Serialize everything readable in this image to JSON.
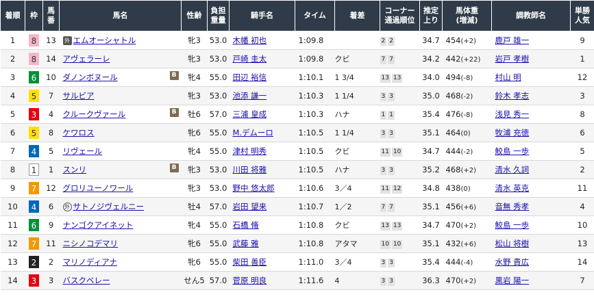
{
  "header": {
    "rank": "着順",
    "waku": "枠",
    "uma_ban": "馬\n番",
    "horse": "馬名",
    "sex_age": "性齢",
    "weight_carried": "負担\n重量",
    "jockey": "騎手名",
    "time": "タイム",
    "margin": "着差",
    "corner": "コーナー\n通過順位",
    "last3f": "推定\n上り",
    "body_weight": "馬体重\n(増減)",
    "trainer": "調教師名",
    "odds": "単勝\n人気"
  },
  "rows": [
    {
      "rank": "1",
      "waku": "8",
      "ban": "13",
      "mark": "kaku",
      "mark_text": "外",
      "horse": "エムオーシャトル",
      "blinker": "",
      "sexage": "牝3",
      "kin": "53.0",
      "jockey": "木幡 初也",
      "time": "1:09.8",
      "margin": "",
      "c1": "2",
      "c2": "2",
      "agari": "34.7",
      "bw": "454",
      "bwd": "(+2)",
      "trainer": "鹿戸 雄一",
      "pop": "9"
    },
    {
      "rank": "2",
      "waku": "8",
      "ban": "14",
      "mark": "",
      "mark_text": "",
      "horse": "アヴェラーレ",
      "blinker": "",
      "sexage": "牝3",
      "kin": "53.0",
      "jockey": "戸崎 圭太",
      "time": "1:09.8",
      "margin": "クビ",
      "c1": "7",
      "c2": "7",
      "agari": "34.2",
      "bw": "442",
      "bwd": "(+22)",
      "trainer": "岩戸 孝樹",
      "pop": "1"
    },
    {
      "rank": "3",
      "waku": "6",
      "ban": "10",
      "mark": "",
      "mark_text": "",
      "horse": "ダノンボヌール",
      "blinker": "B",
      "sexage": "牝4",
      "kin": "55.0",
      "jockey": "田辺 裕信",
      "time": "1:10.1",
      "margin": "1 3/4",
      "c1": "13",
      "c2": "13",
      "agari": "34.0",
      "bw": "494",
      "bwd": "(-8)",
      "trainer": "村山 明",
      "pop": "12"
    },
    {
      "rank": "4",
      "waku": "5",
      "ban": "7",
      "mark": "",
      "mark_text": "",
      "horse": "サルビア",
      "blinker": "",
      "sexage": "牝3",
      "kin": "53.0",
      "jockey": "池添 謙一",
      "time": "1:10.3",
      "margin": "1 1/4",
      "c1": "3",
      "c2": "3",
      "agari": "35.0",
      "bw": "468",
      "bwd": "(-2)",
      "trainer": "鈴木 孝志",
      "pop": "3"
    },
    {
      "rank": "5",
      "waku": "3",
      "ban": "4",
      "mark": "",
      "mark_text": "",
      "horse": "クルークヴァール",
      "blinker": "B",
      "sexage": "牡6",
      "kin": "57.0",
      "jockey": "三浦 皇成",
      "time": "1:10.3",
      "margin": "ハナ",
      "c1": "1",
      "c2": "1",
      "agari": "35.4",
      "bw": "476",
      "bwd": "(-8)",
      "trainer": "浅見 秀一",
      "pop": "8"
    },
    {
      "rank": "6",
      "waku": "5",
      "ban": "8",
      "mark": "",
      "mark_text": "",
      "horse": "ケワロス",
      "blinker": "",
      "sexage": "牝6",
      "kin": "55.0",
      "jockey": "M.デムーロ",
      "time": "1:10.5",
      "margin": "1 1/4",
      "c1": "3",
      "c2": "3",
      "agari": "35.1",
      "bw": "464",
      "bwd": "(0)",
      "trainer": "牧浦 充徳",
      "pop": "6"
    },
    {
      "rank": "7",
      "waku": "4",
      "ban": "5",
      "mark": "",
      "mark_text": "",
      "horse": "リヴェール",
      "blinker": "",
      "sexage": "牝4",
      "kin": "55.0",
      "jockey": "津村 明秀",
      "time": "1:10.5",
      "margin": "クビ",
      "c1": "11",
      "c2": "10",
      "agari": "34.7",
      "bw": "444",
      "bwd": "(-2)",
      "trainer": "鮫島 一歩",
      "pop": "5"
    },
    {
      "rank": "8",
      "waku": "1",
      "ban": "1",
      "mark": "",
      "mark_text": "",
      "horse": "スンリ",
      "blinker": "B",
      "sexage": "牝3",
      "kin": "53.0",
      "jockey": "川田 将雅",
      "time": "1:10.5",
      "margin": "ハナ",
      "c1": "3",
      "c2": "3",
      "agari": "35.2",
      "bw": "468",
      "bwd": "(+2)",
      "trainer": "清水 久詞",
      "pop": "2"
    },
    {
      "rank": "9",
      "waku": "7",
      "ban": "12",
      "mark": "",
      "mark_text": "",
      "horse": "グロリユーノワール",
      "blinker": "",
      "sexage": "牝3",
      "kin": "53.0",
      "jockey": "野中 悠太郎",
      "time": "1:10.6",
      "margin": "3／4",
      "c1": "11",
      "c2": "12",
      "agari": "34.8",
      "bw": "438",
      "bwd": "(0)",
      "trainer": "清水 英克",
      "pop": "11"
    },
    {
      "rank": "10",
      "waku": "4",
      "ban": "6",
      "mark": "maru",
      "mark_text": "外",
      "horse": "サトノジヴェルニー",
      "blinker": "",
      "sexage": "牡4",
      "kin": "57.0",
      "jockey": "岩田 望来",
      "time": "1:10.7",
      "margin": "1／2",
      "c1": "7",
      "c2": "7",
      "agari": "35.1",
      "bw": "456",
      "bwd": "(+6)",
      "trainer": "音無 秀孝",
      "pop": "4"
    },
    {
      "rank": "11",
      "waku": "6",
      "ban": "9",
      "mark": "",
      "mark_text": "",
      "horse": "ナンゴクアイネット",
      "blinker": "",
      "sexage": "牝4",
      "kin": "55.0",
      "jockey": "石橋 脩",
      "time": "1:10.8",
      "margin": "クビ",
      "c1": "13",
      "c2": "13",
      "agari": "34.7",
      "bw": "470",
      "bwd": "(+2)",
      "trainer": "鮫島 一歩",
      "pop": "10"
    },
    {
      "rank": "12",
      "waku": "7",
      "ban": "11",
      "mark": "",
      "mark_text": "",
      "horse": "ニシノコデマリ",
      "blinker": "",
      "sexage": "牝6",
      "kin": "55.0",
      "jockey": "武藤 雅",
      "time": "1:10.8",
      "margin": "アタマ",
      "c1": "10",
      "c2": "10",
      "agari": "35.1",
      "bw": "432",
      "bwd": "(+6)",
      "trainer": "松山 将樹",
      "pop": "13"
    },
    {
      "rank": "13",
      "waku": "2",
      "ban": "2",
      "mark": "",
      "mark_text": "",
      "horse": "マリノディアナ",
      "blinker": "",
      "sexage": "牝6",
      "kin": "55.0",
      "jockey": "柴田 善臣",
      "time": "1:11.0",
      "margin": "3／4",
      "c1": "3",
      "c2": "3",
      "agari": "35.4",
      "bw": "444",
      "bwd": "(-4)",
      "trainer": "水野 貴広",
      "pop": "14"
    },
    {
      "rank": "14",
      "waku": "3",
      "ban": "3",
      "mark": "",
      "mark_text": "",
      "horse": "バスクベレー",
      "blinker": "",
      "sexage": "せん5",
      "kin": "57.0",
      "jockey": "菅原 明良",
      "time": "1:11.6",
      "margin": "4",
      "c1": "3",
      "c2": "3",
      "agari": "36.3",
      "bw": "470",
      "bwd": "(+2)",
      "trainer": "黒岩 陽一",
      "pop": "7"
    }
  ],
  "waku_colors": {
    "1": {
      "bg": "#ffffff",
      "fg": "#333333",
      "border": "#999999"
    },
    "2": {
      "bg": "#222222",
      "fg": "#ffffff",
      "border": "#222222"
    },
    "3": {
      "bg": "#e60012",
      "fg": "#ffffff",
      "border": "#e60012"
    },
    "4": {
      "bg": "#0068b7",
      "fg": "#ffffff",
      "border": "#0068b7"
    },
    "5": {
      "bg": "#ffe100",
      "fg": "#333333",
      "border": "#ffe100"
    },
    "6": {
      "bg": "#00913a",
      "fg": "#ffffff",
      "border": "#00913a"
    },
    "7": {
      "bg": "#f39800",
      "fg": "#ffffff",
      "border": "#f39800"
    },
    "8": {
      "bg": "#f6b6c8",
      "fg": "#333333",
      "border": "#f6b6c8"
    }
  }
}
